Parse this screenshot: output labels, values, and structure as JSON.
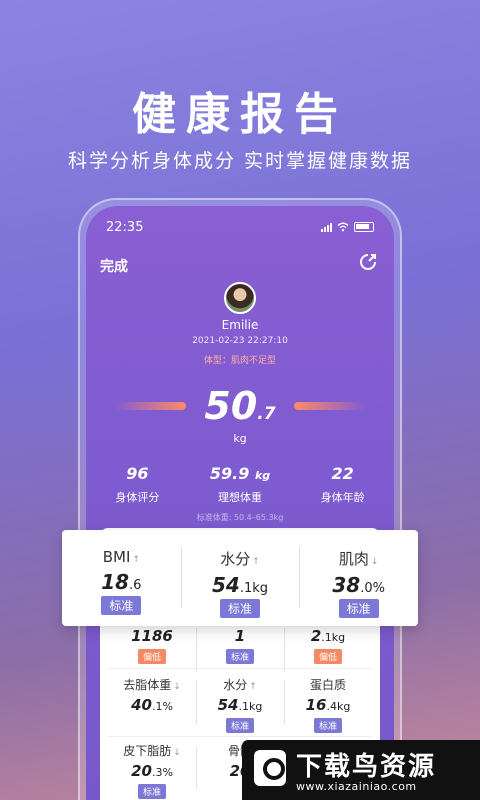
{
  "promo": {
    "title": "健康报告",
    "subtitle": "科学分析身体成分  实时掌握健康数据"
  },
  "status_bar": {
    "time": "22:35"
  },
  "header": {
    "done_label": "完成",
    "share_icon": "share-icon"
  },
  "profile": {
    "name": "Emilie",
    "datetime": "2021-02-23 22:27:10",
    "body_type": "体型：肌肉不足型"
  },
  "weight": {
    "integer": "50",
    "decimal": ".7",
    "unit": "kg"
  },
  "summary": [
    {
      "value": "96",
      "unit": "",
      "label": "身体评分"
    },
    {
      "value": "59.9",
      "unit": "kg",
      "label": "理想体重"
    },
    {
      "value": "22",
      "unit": "",
      "label": "身体年龄"
    }
  ],
  "standard_weight_range": "标准体重: 50.4–65.3kg",
  "metrics_row1": [
    {
      "label": "BMI",
      "arrow": "↑",
      "int": "18",
      "dec": ".6",
      "unit": "",
      "tag": "标准",
      "tag_type": "std"
    },
    {
      "label": "水分",
      "arrow": "↑",
      "int": "54",
      "dec": ".1",
      "unit": "kg",
      "tag": "标准",
      "tag_type": "std"
    },
    {
      "label": "肌肉",
      "arrow": "↓",
      "int": "38",
      "dec": ".0",
      "unit": "%",
      "tag": "标准",
      "tag_type": "std"
    }
  ],
  "metrics_row2": [
    {
      "value": "1186",
      "dec": "",
      "unit": "",
      "tag": "偏低",
      "tag_type": "low"
    },
    {
      "value": "1",
      "dec": "",
      "unit": "",
      "tag": "标准",
      "tag_type": "std"
    },
    {
      "value": "2",
      "dec": ".1",
      "unit": "kg",
      "tag": "偏低",
      "tag_type": "low"
    }
  ],
  "metrics_row3": [
    {
      "label": "去脂体重",
      "arrow": "↓",
      "int": "40",
      "dec": ".1",
      "unit": "%",
      "tag": "",
      "tag_type": ""
    },
    {
      "label": "水分",
      "arrow": "↑",
      "int": "54",
      "dec": ".1",
      "unit": "kg",
      "tag": "标准",
      "tag_type": "std"
    },
    {
      "label": "蛋白质",
      "arrow": "",
      "int": "16",
      "dec": ".4",
      "unit": "kg",
      "tag": "标准",
      "tag_type": "std"
    }
  ],
  "metrics_row4": [
    {
      "label": "皮下脂肪",
      "arrow": "↓",
      "int": "20",
      "dec": ".3",
      "unit": "%",
      "tag": "标准",
      "tag_type": "std"
    },
    {
      "label": "骨骼",
      "arrow": "",
      "int": "20",
      "dec": "",
      "unit": "",
      "tag": "",
      "tag_type": ""
    }
  ],
  "watermark": {
    "text": "下载鸟资源",
    "url": "www.xiazainiao.com"
  },
  "colors": {
    "accent": "#7c78d6",
    "low": "#f48a62",
    "bar": "#ff8a6a"
  }
}
